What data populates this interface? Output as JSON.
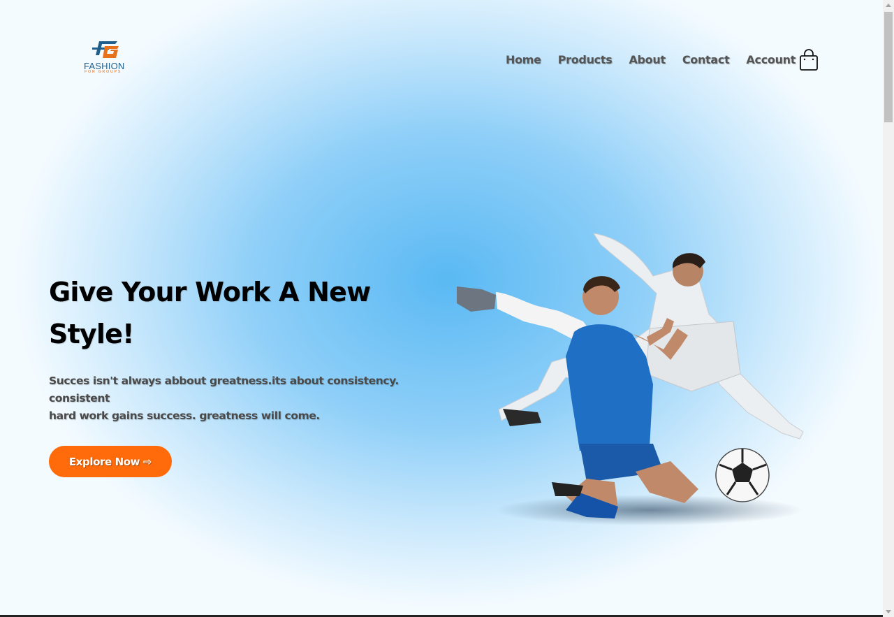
{
  "brand": {
    "name": "FASHION",
    "tagline": "FOR GROUPS"
  },
  "nav": {
    "items": [
      "Home",
      "Products",
      "About",
      "Contact",
      "Account"
    ]
  },
  "hero": {
    "title": "Give Your Work A New Style!",
    "text_lines": [
      "Succes isn't always abbout greatness.its about consistency.",
      "consistent",
      "hard work gains success. greatness will come."
    ],
    "cta_label": "Explore Now ⇨"
  },
  "colors": {
    "accent": "#ff6b0a",
    "brand_blue": "#1f5f8b",
    "brand_orange": "#e8721c",
    "sky": "#5ab9f3"
  },
  "icons": {
    "cart": "shopping-bag-icon"
  }
}
